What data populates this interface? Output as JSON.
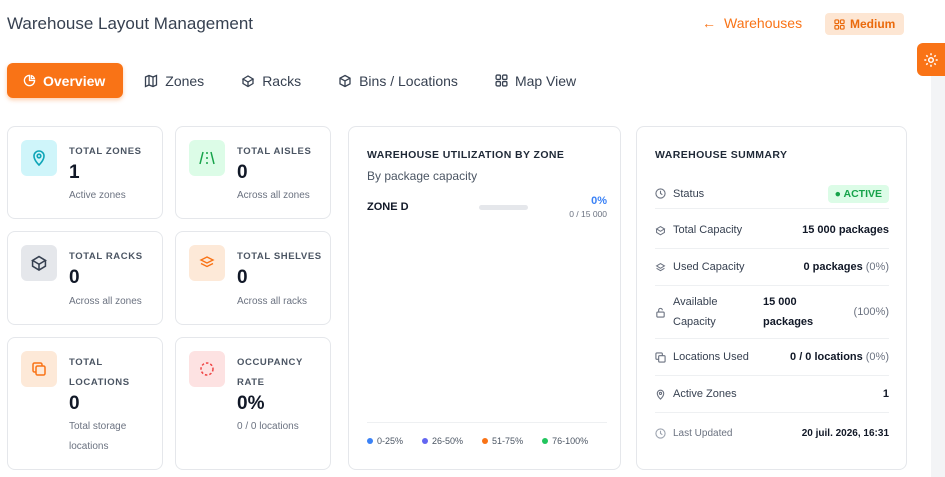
{
  "header": {
    "title": "Warehouse Layout Management",
    "back_label": "Warehouses",
    "size_badge": "Medium"
  },
  "tabs": [
    {
      "label": "Overview",
      "icon": "pie-chart-icon"
    },
    {
      "label": "Zones",
      "icon": "map-icon"
    },
    {
      "label": "Racks",
      "icon": "box-icon"
    },
    {
      "label": "Bins / Locations",
      "icon": "package-icon"
    },
    {
      "label": "Map View",
      "icon": "grid-icon"
    }
  ],
  "stats": [
    {
      "label": "TOTAL ZONES",
      "value": "1",
      "sub": "Active zones",
      "icon": "map-pin-icon",
      "color": "#0ea5b7"
    },
    {
      "label": "TOTAL AISLES",
      "value": "0",
      "sub": "Across all zones",
      "icon": "road-icon",
      "color": "#16a34a"
    },
    {
      "label": "TOTAL RACKS",
      "value": "0",
      "sub": "Across all zones",
      "icon": "box-icon",
      "color": "#374151"
    },
    {
      "label": "TOTAL SHELVES",
      "value": "0",
      "sub": "Across all racks",
      "icon": "layers-icon",
      "color": "#f97316"
    },
    {
      "label": "TOTAL LOCATIONS",
      "value": "0",
      "sub": "Total storage locations",
      "icon": "copy-icon",
      "color": "#f97316"
    },
    {
      "label": "OCCUPANCY RATE",
      "value": "0%",
      "sub": "0 / 0 locations",
      "icon": "loader-circle-icon",
      "color": "#ef4444"
    }
  ],
  "utilization": {
    "title": "WAREHOUSE UTILIZATION BY ZONE",
    "subtitle": "By package capacity",
    "zones": [
      {
        "name": "ZONE D",
        "percent": "0%",
        "capacity": "0 / 15 000",
        "fill": 0
      }
    ],
    "legend": [
      {
        "label": "0-25%",
        "color": "#3b82f6"
      },
      {
        "label": "26-50%",
        "color": "#6366f1"
      },
      {
        "label": "51-75%",
        "color": "#f97316"
      },
      {
        "label": "76-100%",
        "color": "#22c55e"
      }
    ]
  },
  "summary": {
    "title": "WAREHOUSE SUMMARY",
    "status_label": "Status",
    "status_value": "● ACTIVE",
    "total_capacity_label": "Total Capacity",
    "total_capacity_value": "15 000 packages",
    "used_capacity_label": "Used Capacity",
    "used_capacity_value": "0 packages",
    "used_capacity_pct": "(0%)",
    "available_label_1": "Available",
    "available_label_2": "Capacity",
    "available_value_1": "15 000",
    "available_value_2": "packages",
    "available_pct": "(100%)",
    "locations_used_label": "Locations Used",
    "locations_used_value": "0 / 0 locations",
    "locations_used_pct": "(0%)",
    "active_zones_label": "Active Zones",
    "active_zones_value": "1",
    "last_updated_label": "Last Updated",
    "last_updated_value": "20 juil. 2026, 16:31"
  }
}
